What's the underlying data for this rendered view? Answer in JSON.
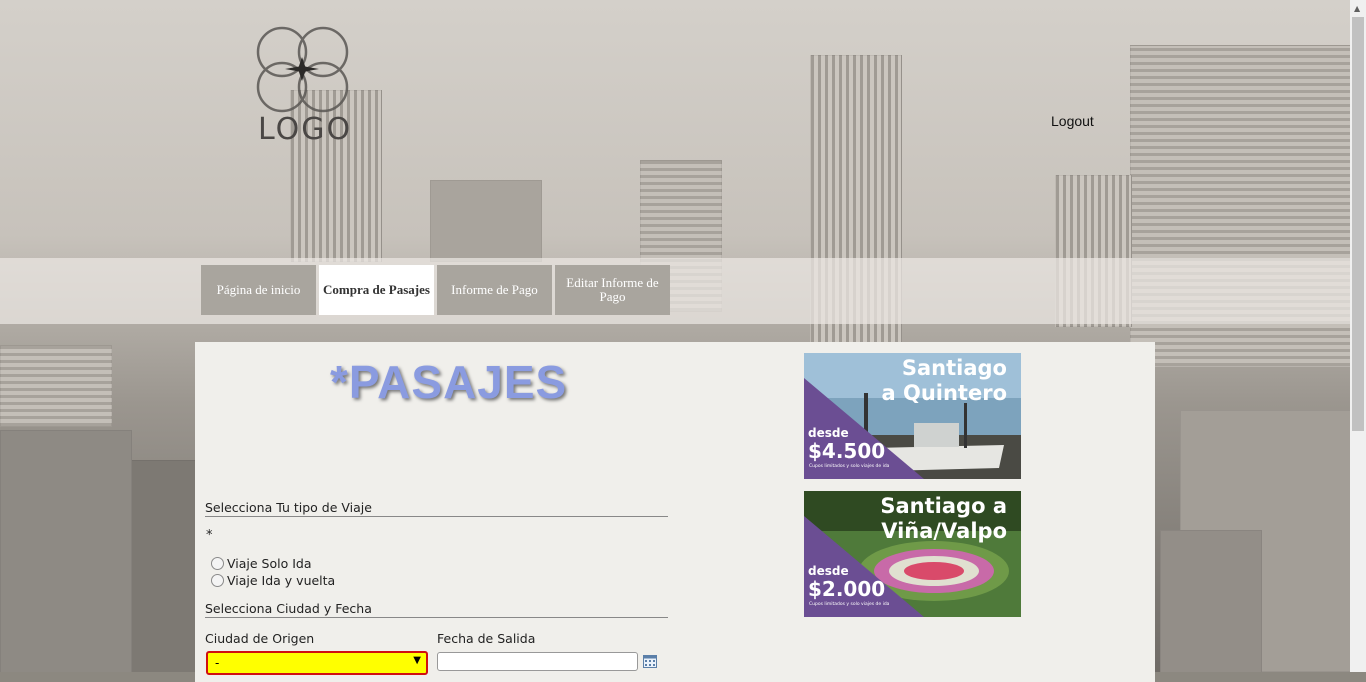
{
  "header": {
    "logo_text": "LOGO",
    "logout_label": "Logout"
  },
  "nav": {
    "tabs": [
      {
        "label": "Página de inicio",
        "active": false
      },
      {
        "label": "Compra de Pasajes",
        "active": true
      },
      {
        "label": "Informe de Pago",
        "active": false
      },
      {
        "label": "Editar Informe de Pago",
        "active": false
      }
    ]
  },
  "main": {
    "title": "*PASAJES",
    "trip_type_heading": "Selecciona Tu tipo de Viaje",
    "required_mark": "*",
    "trip_options": [
      "Viaje Solo Ida",
      "Viaje Ida y vuelta"
    ],
    "city_date_heading": "Selecciona Ciudad y Fecha",
    "origin_label": "Ciudad de Origen",
    "origin_value": "-",
    "departure_label": "Fecha de Salida",
    "departure_value": ""
  },
  "promos": [
    {
      "title_line1": "Santiago",
      "title_line2": "a Quintero",
      "desde": "desde",
      "price": "$4.500",
      "fine": "Cupos limitados y solo viajes de ida"
    },
    {
      "title_line1": "Santiago a",
      "title_line2": "Viña/Valpo",
      "desde": "desde",
      "price": "$2.000",
      "fine": "Cupos limitados y solo viajes de ida"
    }
  ],
  "colors": {
    "title": "#8a9be0",
    "promo_purple": "#6b4e93",
    "select_bg": "#ffff00",
    "select_border": "#d01010",
    "tab_bg": "#a9a59e"
  },
  "icons": {
    "calendar": "calendar-icon",
    "dropdown": "chevron-down-icon"
  }
}
